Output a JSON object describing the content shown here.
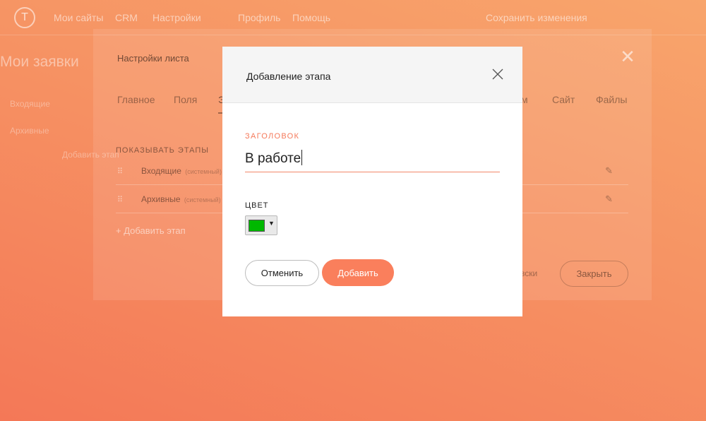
{
  "topbar": {
    "nav": [
      "Мои сайты",
      "CRM",
      "Настройки",
      "Профиль",
      "Помощь"
    ],
    "right_link": "Сохранить изменения"
  },
  "page": {
    "title": "Мои заявки",
    "sidebar": [
      "Входящие",
      "Архивные",
      "Добавить этап"
    ]
  },
  "settings": {
    "title": "Настройки листа",
    "tabs": [
      "Главное",
      "Поля",
      "Э",
      "м",
      "Сайт",
      "Файлы"
    ],
    "stages_heading": "Показывать этапы",
    "stages": [
      {
        "name": "Входящие",
        "meta": "(системный)"
      },
      {
        "name": "Архивные",
        "meta": "(системный)"
      }
    ],
    "add_stage": "+ Добавить этап",
    "security_label": "вски",
    "close_label": "Закрыть"
  },
  "dialog": {
    "title": "Добавление этапа",
    "field_title_label": "Заголовок",
    "field_title_value": "В работе",
    "color_label": "Цвет",
    "color_value": "#00b800",
    "cancel_label": "Отменить",
    "add_label": "Добавить"
  },
  "colors": {
    "accent": "#fa7f5c",
    "label_accent": "#f5795a"
  }
}
